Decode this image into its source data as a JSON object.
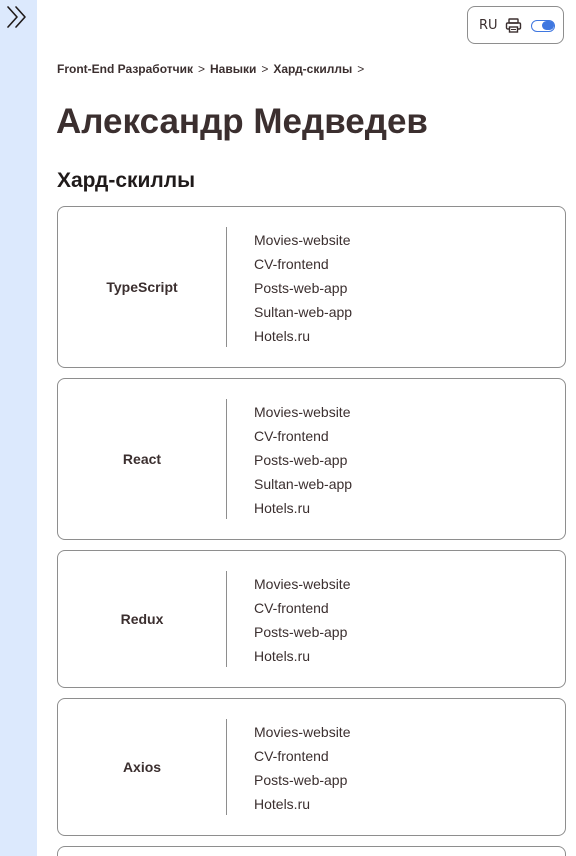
{
  "header": {
    "lang": "RU",
    "print_icon": "printer-icon",
    "sidebar_icon": "chevron-double-right-icon",
    "theme_toggle_state": "on",
    "accent_color": "#3f77e0",
    "sidebar_color": "#dce9fd"
  },
  "breadcrumb": {
    "items": [
      "Front-End Разработчик",
      "Навыки",
      "Хард-скиллы"
    ],
    "separator": ">"
  },
  "page_title": "Александр Медведев",
  "section_title": "Хард-скиллы",
  "skills": [
    {
      "name": "TypeScript",
      "projects": [
        "Movies-website",
        "CV-frontend",
        "Posts-web-app",
        "Sultan-web-app",
        "Hotels.ru"
      ]
    },
    {
      "name": "React",
      "projects": [
        "Movies-website",
        "CV-frontend",
        "Posts-web-app",
        "Sultan-web-app",
        "Hotels.ru"
      ]
    },
    {
      "name": "Redux",
      "projects": [
        "Movies-website",
        "CV-frontend",
        "Posts-web-app",
        "Hotels.ru"
      ]
    },
    {
      "name": "Axios",
      "projects": [
        "Movies-website",
        "CV-frontend",
        "Posts-web-app",
        "Hotels.ru"
      ]
    }
  ]
}
